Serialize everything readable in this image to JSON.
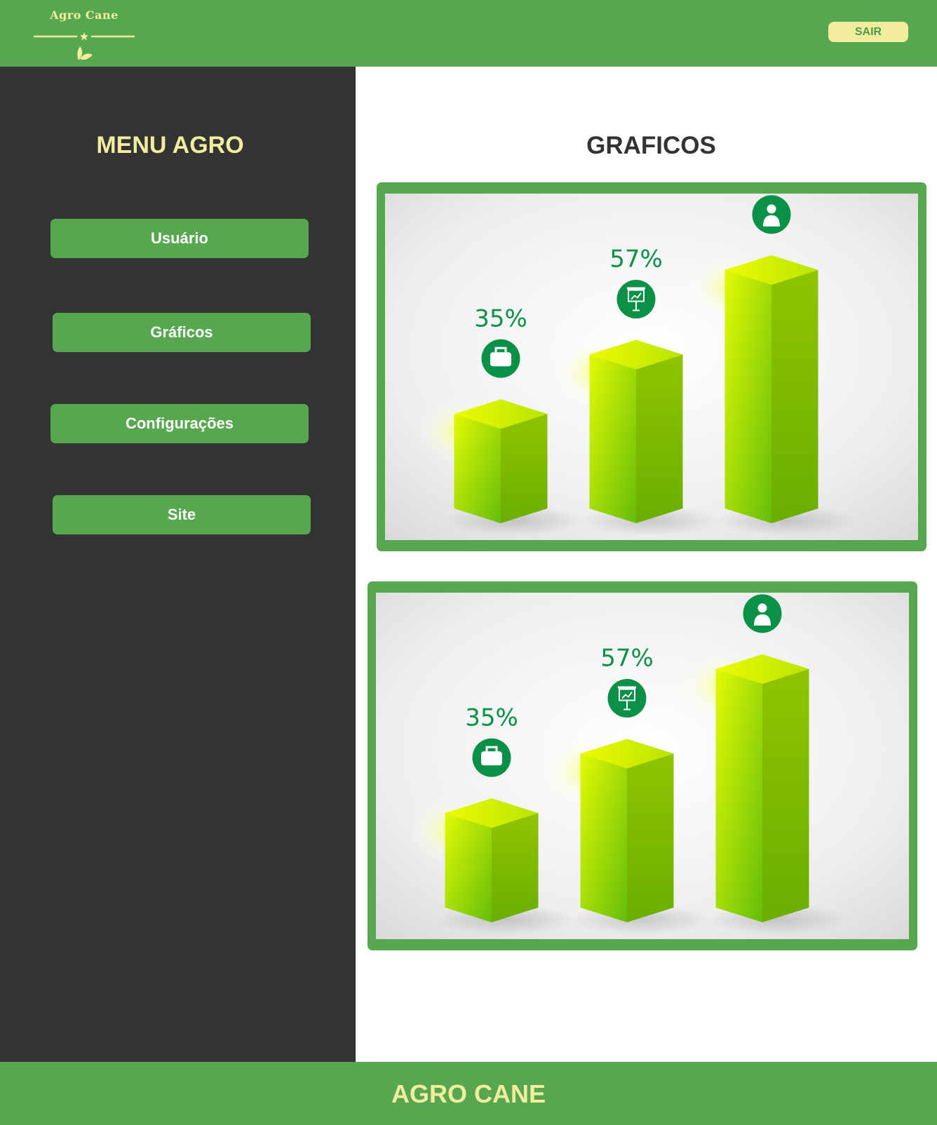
{
  "header": {
    "logo_text": "Agro Cane",
    "logout_label": "SAIR"
  },
  "sidebar": {
    "title": "MENU AGRO",
    "items": [
      {
        "label": "Usuário"
      },
      {
        "label": "Gráficos"
      },
      {
        "label": "Configurações"
      },
      {
        "label": "Site"
      }
    ]
  },
  "main": {
    "title": "GRAFICOS"
  },
  "charts": [
    {
      "labels": [
        "35%",
        "57%"
      ],
      "icons": [
        "briefcase-icon",
        "presentation-icon",
        "user-icon"
      ]
    },
    {
      "labels": [
        "35%",
        "57%"
      ],
      "icons": [
        "briefcase-icon",
        "presentation-icon",
        "user-icon"
      ]
    }
  ],
  "chart_data": [
    {
      "type": "bar",
      "values": [
        35,
        57,
        null
      ]
    },
    {
      "type": "bar",
      "values": [
        35,
        57,
        null
      ]
    }
  ],
  "footer": {
    "text": "AGRO CANE"
  },
  "colors": {
    "brand_green": "#57a750",
    "accent_yellow": "#f2ec9f",
    "sidebar_dark": "#333333",
    "icon_green": "#0a9147"
  }
}
